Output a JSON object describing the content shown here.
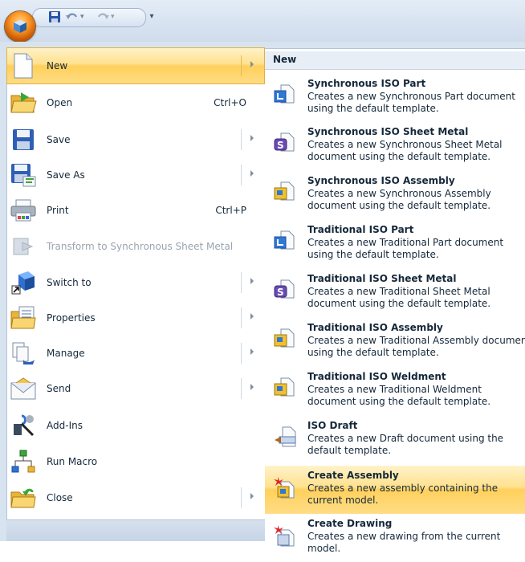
{
  "quick_access": {
    "orb_icon": "solid-edge-logo-icon",
    "buttons": [
      "save-icon",
      "undo-icon",
      "redo-icon"
    ],
    "more_glyph": "▾"
  },
  "menu": {
    "items": [
      {
        "label": "New",
        "icon": "new-document-icon",
        "shortcut": "",
        "submenu": true,
        "highlighted": true,
        "disabled": false
      },
      {
        "label": "Open",
        "icon": "open-folder-icon",
        "shortcut": "Ctrl+O",
        "submenu": false,
        "highlighted": false,
        "disabled": false
      },
      {
        "label": "Save",
        "icon": "save-disk-icon",
        "shortcut": "",
        "submenu": true,
        "highlighted": false,
        "disabled": false
      },
      {
        "label": "Save As",
        "icon": "save-as-icon",
        "shortcut": "",
        "submenu": true,
        "highlighted": false,
        "disabled": false
      },
      {
        "label": "Print",
        "icon": "printer-icon",
        "shortcut": "Ctrl+P",
        "submenu": false,
        "highlighted": false,
        "disabled": false
      },
      {
        "label": "Transform to Synchronous Sheet Metal",
        "icon": "transform-icon",
        "shortcut": "",
        "submenu": false,
        "highlighted": false,
        "disabled": true
      },
      {
        "label": "Switch to",
        "icon": "switch-to-icon",
        "shortcut": "",
        "submenu": true,
        "highlighted": false,
        "disabled": false
      },
      {
        "label": "Properties",
        "icon": "properties-icon",
        "shortcut": "",
        "submenu": true,
        "highlighted": false,
        "disabled": false
      },
      {
        "label": "Manage",
        "icon": "manage-icon",
        "shortcut": "",
        "submenu": true,
        "highlighted": false,
        "disabled": false
      },
      {
        "label": "Send",
        "icon": "send-envelope-icon",
        "shortcut": "",
        "submenu": true,
        "highlighted": false,
        "disabled": false
      },
      {
        "label": "Add-Ins",
        "icon": "add-ins-icon",
        "shortcut": "",
        "submenu": false,
        "highlighted": false,
        "disabled": false
      },
      {
        "label": "Run Macro",
        "icon": "run-macro-icon",
        "shortcut": "",
        "submenu": false,
        "highlighted": false,
        "disabled": false
      },
      {
        "label": "Close",
        "icon": "close-folder-icon",
        "shortcut": "",
        "submenu": true,
        "highlighted": false,
        "disabled": false
      }
    ]
  },
  "submenu": {
    "header": "New",
    "items": [
      {
        "title": "Synchronous ISO Part",
        "desc": "Creates a new Synchronous Part document using the default template.",
        "icon": "part-doc-icon",
        "highlighted": false
      },
      {
        "title": "Synchronous ISO Sheet Metal",
        "desc": "Creates a new Synchronous Sheet Metal document using the default template.",
        "icon": "sheet-metal-doc-icon",
        "highlighted": false
      },
      {
        "title": "Synchronous ISO Assembly",
        "desc": "Creates a new Synchronous Assembly document using the default template.",
        "icon": "assembly-doc-icon",
        "highlighted": false
      },
      {
        "title": "Traditional ISO Part",
        "desc": "Creates a new Traditional Part document using the default template.",
        "icon": "part-doc-icon",
        "highlighted": false
      },
      {
        "title": "Traditional ISO Sheet Metal",
        "desc": "Creates a new Traditional Sheet Metal document using the default template.",
        "icon": "sheet-metal-doc-icon",
        "highlighted": false
      },
      {
        "title": "Traditional ISO Assembly",
        "desc": "Creates a new Traditional Assembly document using the default template.",
        "icon": "assembly-doc-icon",
        "highlighted": false
      },
      {
        "title": "Traditional ISO Weldment",
        "desc": "Creates a new Traditional Weldment document using the default template.",
        "icon": "assembly-doc-icon",
        "highlighted": false
      },
      {
        "title": "ISO Draft",
        "desc": "Creates a new Draft document using the default template.",
        "icon": "draft-doc-icon",
        "highlighted": false
      },
      {
        "title": "Create Assembly",
        "desc": "Creates a new assembly containing the current model.",
        "icon": "create-assembly-icon",
        "highlighted": true
      },
      {
        "title": "Create Drawing",
        "desc": "Creates a new drawing from the current model.",
        "icon": "create-drawing-icon",
        "highlighted": false
      }
    ]
  }
}
